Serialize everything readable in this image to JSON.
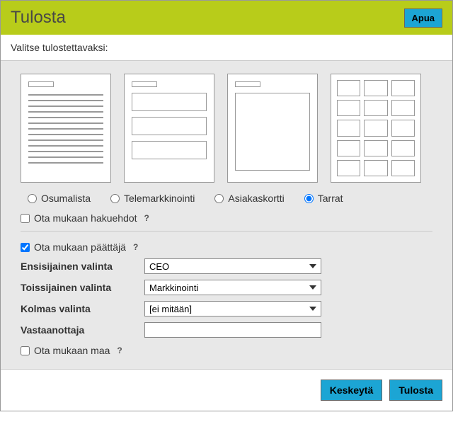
{
  "header": {
    "title": "Tulosta",
    "help": "Apua"
  },
  "subtitle": "Valitse tulostettavaksi:",
  "options": {
    "osumalista": "Osumalista",
    "telemarkkinointi": "Telemarkkinointi",
    "asiakaskortti": "Asiakaskortti",
    "tarrat": "Tarrat",
    "selected": "tarrat"
  },
  "checkboxes": {
    "hakuehdot": {
      "label": "Ota mukaan hakuehdot",
      "checked": false
    },
    "paattaja": {
      "label": "Ota mukaan päättäjä",
      "checked": true
    },
    "maa": {
      "label": "Ota mukaan maa",
      "checked": false
    }
  },
  "form": {
    "ensisijainen": {
      "label": "Ensisijainen valinta",
      "value": "CEO"
    },
    "toissijainen": {
      "label": "Toissijainen valinta",
      "value": "Markkinointi"
    },
    "kolmas": {
      "label": "Kolmas valinta",
      "value": "[ei mitään]"
    },
    "vastaanottaja": {
      "label": "Vastaanottaja",
      "value": ""
    }
  },
  "footer": {
    "cancel": "Keskeytä",
    "print": "Tulosta"
  },
  "help_glyph": "?"
}
